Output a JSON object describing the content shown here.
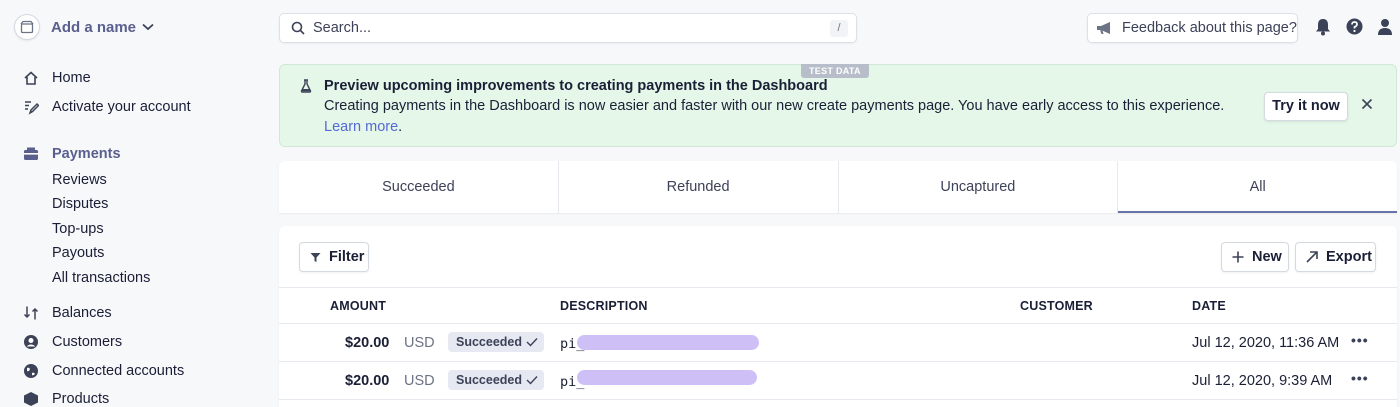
{
  "sidebar": {
    "account_name": "Add a name",
    "items": [
      {
        "label": "Home",
        "icon": "home-icon"
      },
      {
        "label": "Activate your account",
        "icon": "pencil-icon"
      },
      {
        "label": "Payments",
        "icon": "payments-icon",
        "active": true
      },
      {
        "label": "Balances",
        "icon": "balances-icon"
      },
      {
        "label": "Customers",
        "icon": "customers-icon"
      },
      {
        "label": "Connected accounts",
        "icon": "globe-icon"
      },
      {
        "label": "Products",
        "icon": "products-icon"
      }
    ],
    "payments_sub": [
      "Reviews",
      "Disputes",
      "Top-ups",
      "Payouts",
      "All transactions"
    ]
  },
  "topbar": {
    "search_placeholder": "Search...",
    "search_shortcut": "/",
    "feedback_label": "Feedback about this page?"
  },
  "banner": {
    "badge": "TEST DATA",
    "title": "Preview upcoming improvements to creating payments in the Dashboard",
    "text": "Creating payments in the Dashboard is now easier and faster with our new create payments page. You have early access to this experience.",
    "link": "Learn more",
    "link_suffix": ".",
    "button": "Try it now"
  },
  "tabs": [
    {
      "label": "Succeeded"
    },
    {
      "label": "Refunded"
    },
    {
      "label": "Uncaptured"
    },
    {
      "label": "All",
      "active": true
    }
  ],
  "toolbar": {
    "filter": "Filter",
    "new": "New",
    "export": "Export"
  },
  "table": {
    "headers": [
      "AMOUNT",
      "DESCRIPTION",
      "CUSTOMER",
      "DATE"
    ],
    "rows": [
      {
        "amount": "$20.00",
        "currency": "USD",
        "status": "Succeeded",
        "description": "pi_",
        "customer": "",
        "date": "Jul 12, 2020, 11:36 AM"
      },
      {
        "amount": "$20.00",
        "currency": "USD",
        "status": "Succeeded",
        "description": "pi_",
        "customer": "",
        "date": "Jul 12, 2020, 9:39 AM"
      }
    ]
  },
  "colors": {
    "accent": "#5a5f8e",
    "link": "#5469d4",
    "banner_bg": "#e4f7e9",
    "badge_bg": "#e6e9f2",
    "redaction": "#c9b8f5"
  }
}
